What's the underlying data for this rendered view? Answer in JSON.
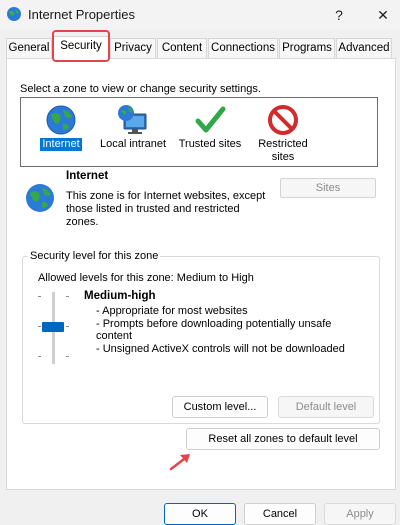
{
  "window": {
    "title": "Internet Properties",
    "help": "?",
    "close": "✕"
  },
  "tabs": [
    {
      "label": "General"
    },
    {
      "label": "Security"
    },
    {
      "label": "Privacy"
    },
    {
      "label": "Content"
    },
    {
      "label": "Connections"
    },
    {
      "label": "Programs"
    },
    {
      "label": "Advanced"
    }
  ],
  "security": {
    "prompt": "Select a zone to view or change security settings.",
    "zones": [
      {
        "label": "Internet",
        "selected": true,
        "icon": "globe-icon"
      },
      {
        "label": "Local intranet",
        "icon": "monitor-globe-icon"
      },
      {
        "label": "Trusted sites",
        "icon": "checkmark-icon"
      },
      {
        "label": "Restricted sites",
        "icon": "no-entry-icon"
      }
    ],
    "selected_zone": {
      "name": "Internet",
      "description": "This zone is for Internet websites, except those listed in trusted and restricted zones."
    },
    "sites_button": "Sites",
    "level_group": {
      "legend": "Security level for this zone",
      "allowed": "Allowed levels for this zone: Medium to High",
      "level_name": "Medium-high",
      "lines": [
        "- Appropriate for most websites",
        "- Prompts before downloading potentially unsafe content",
        "- Unsigned ActiveX controls will not be downloaded"
      ],
      "custom_button": "Custom level...",
      "default_button": "Default level"
    },
    "reset_button": "Reset all zones to default level"
  },
  "footer": {
    "ok": "OK",
    "cancel": "Cancel",
    "apply": "Apply"
  },
  "colors": {
    "accent": "#0078d7",
    "highlight": "#e5454a"
  }
}
